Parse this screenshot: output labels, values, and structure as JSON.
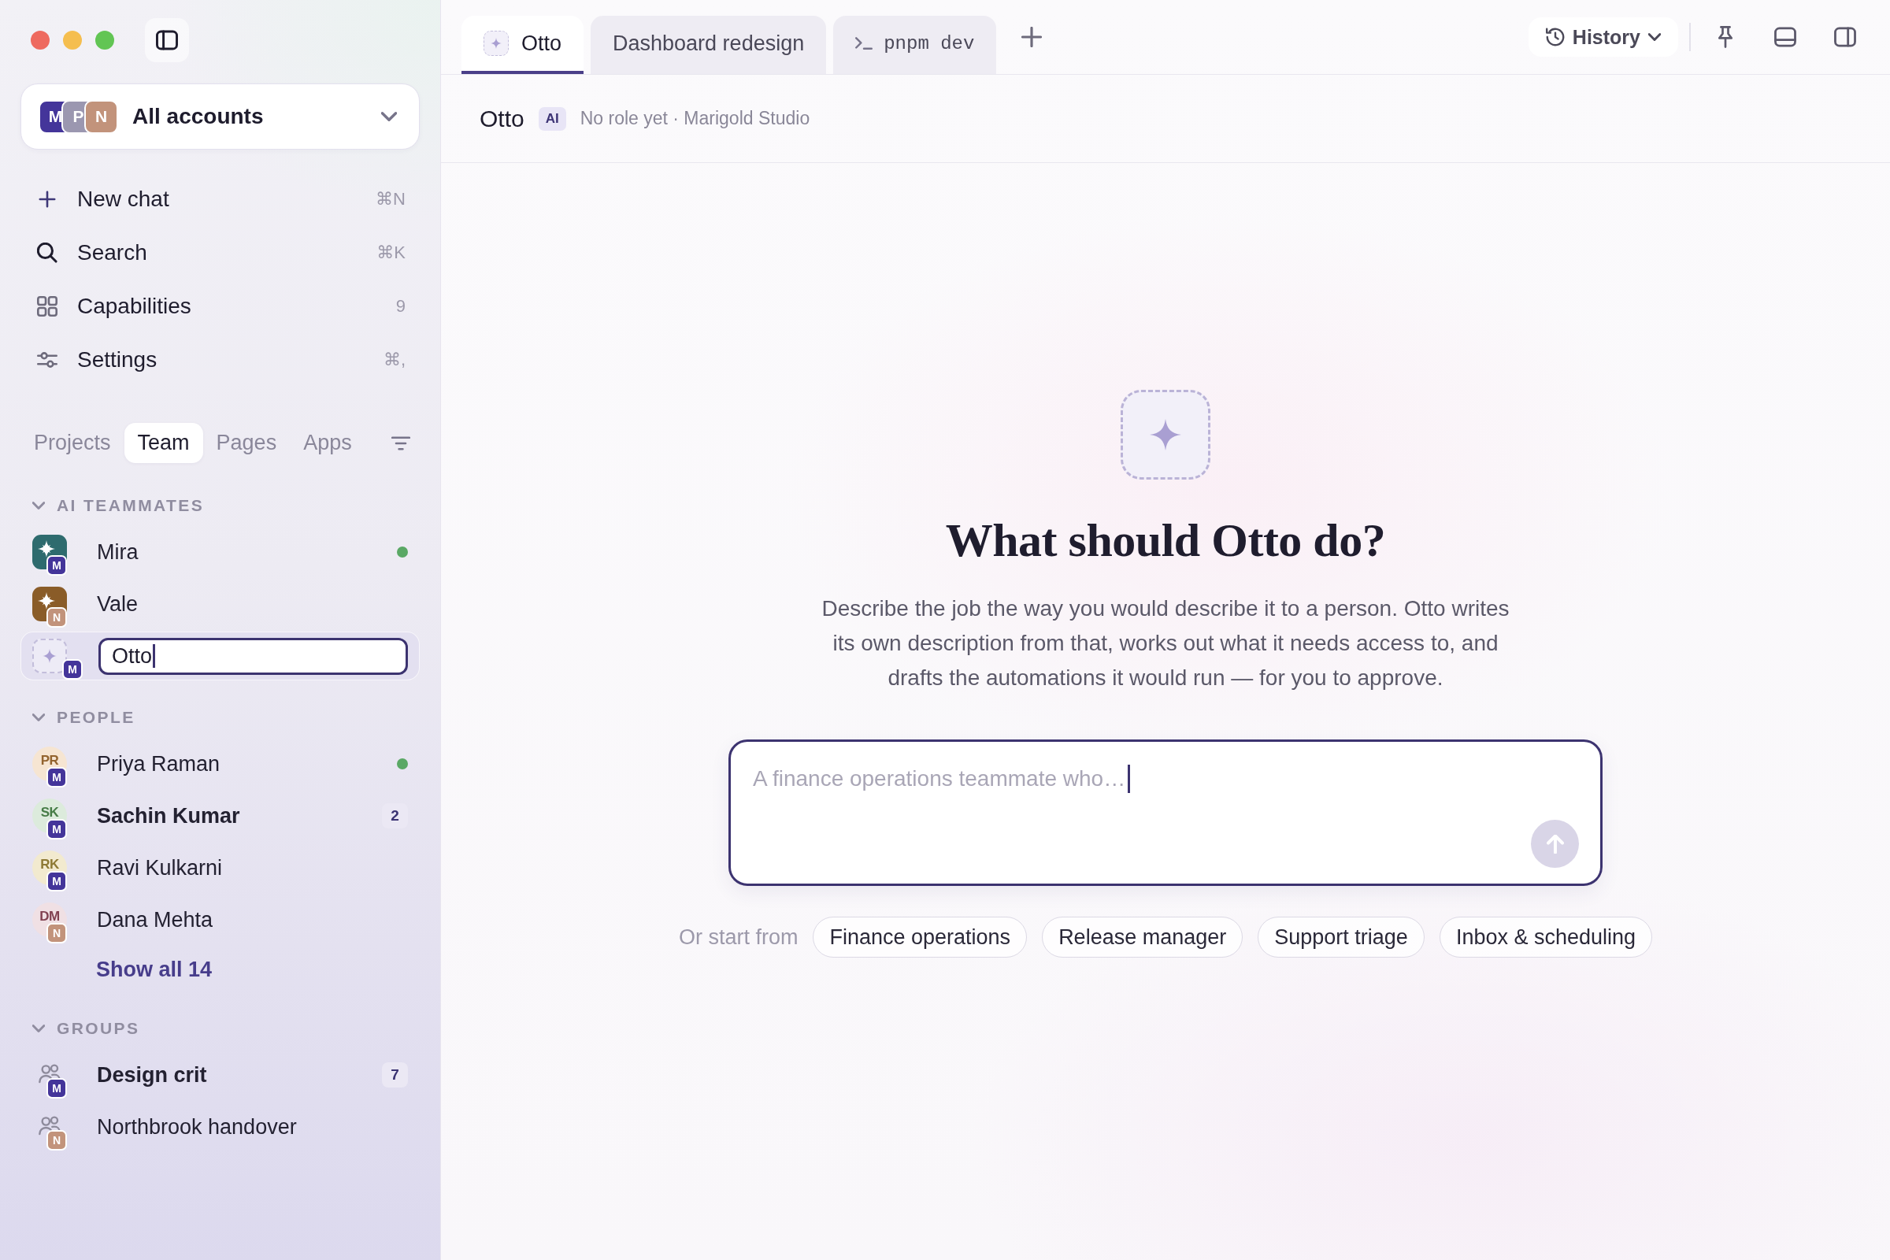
{
  "sidebar": {
    "account_switcher": {
      "label": "All accounts",
      "accounts": [
        {
          "letter": "M",
          "color": "#44359a"
        },
        {
          "letter": "P",
          "color": "#9b97b0"
        },
        {
          "letter": "N",
          "color": "#c2937b"
        }
      ]
    },
    "nav": [
      {
        "label": "New chat",
        "shortcut": "⌘N"
      },
      {
        "label": "Search",
        "shortcut": "⌘K"
      },
      {
        "label": "Capabilities",
        "count": "9"
      },
      {
        "label": "Settings",
        "shortcut": "⌘,"
      }
    ],
    "tabs": [
      {
        "label": "Projects",
        "selected": false
      },
      {
        "label": "Team",
        "selected": true
      },
      {
        "label": "Pages",
        "selected": false
      },
      {
        "label": "Apps",
        "selected": false
      }
    ],
    "sections": [
      {
        "title": "AI TEAMMATES",
        "expanded": true,
        "items": [
          {
            "kind": "teammate",
            "name": "Mira",
            "color": "#2e6b6e",
            "account": {
              "letter": "M",
              "color": "#44359a"
            },
            "online": true,
            "unread": false,
            "selected": false
          },
          {
            "kind": "teammate",
            "name": "Vale",
            "color": "#8a5c28",
            "account": {
              "letter": "N",
              "color": "#c2937b"
            },
            "online": false,
            "unread": false,
            "selected": false
          },
          {
            "kind": "draft",
            "value": "Otto",
            "account": {
              "letter": "M",
              "color": "#44359a"
            },
            "selected": true
          }
        ]
      },
      {
        "title": "PEOPLE",
        "expanded": true,
        "items": [
          {
            "kind": "person",
            "name": "Priya Raman",
            "initials": "PR",
            "color": "#f6e5d2",
            "account": {
              "letter": "M",
              "color": "#44359a"
            },
            "online": true,
            "unread": false,
            "selected": false
          },
          {
            "kind": "person",
            "name": "Sachin Kumar",
            "initials": "SK",
            "color": "#dcebdc",
            "account": {
              "letter": "M",
              "color": "#44359a"
            },
            "online": false,
            "unread": true,
            "count": "2",
            "selected": false
          },
          {
            "kind": "person",
            "name": "Ravi Kulkarni",
            "initials": "RK",
            "color": "#f2eacf",
            "account": {
              "letter": "M",
              "color": "#44359a"
            },
            "online": false,
            "unread": false,
            "selected": false
          },
          {
            "kind": "person",
            "name": "Dana Mehta",
            "initials": "DM",
            "color": "#f0e0e4",
            "account": {
              "letter": "N",
              "color": "#c2937b"
            },
            "online": false,
            "unread": false,
            "selected": false
          }
        ],
        "more": "Show all 14"
      },
      {
        "title": "GROUPS",
        "expanded": true,
        "items": [
          {
            "kind": "group",
            "name": "Design crit",
            "account": {
              "letter": "M",
              "color": "#44359a"
            },
            "unread": true,
            "count": "7",
            "selected": false
          },
          {
            "kind": "group",
            "name": "Northbrook handover",
            "account": {
              "letter": "N",
              "color": "#c2937b"
            },
            "unread": false,
            "selected": false
          }
        ]
      }
    ]
  },
  "main": {
    "tabs": [
      {
        "kind": "agent",
        "label": "Otto",
        "selected": true
      },
      {
        "kind": "page",
        "label": "Dashboard redesign",
        "selected": false
      },
      {
        "kind": "terminal",
        "label": "pnpm dev",
        "selected": false
      }
    ],
    "history_button": "History",
    "header": {
      "title": "Otto",
      "badge": "AI",
      "subtitle": "No role yet · Marigold Studio"
    },
    "empty_state": {
      "title": "What should Otto do?",
      "description": "Describe the job the way you would describe it to a person. Otto writes its own description from that, works out what it needs access to, and drafts the automations it would run — for you to approve.",
      "prompt": {
        "placeholder": "A finance operations teammate who…"
      },
      "suggestions_label": "Or start from",
      "suggestions": [
        "Finance operations",
        "Release manager",
        "Support triage",
        "Inbox & scheduling"
      ]
    }
  }
}
